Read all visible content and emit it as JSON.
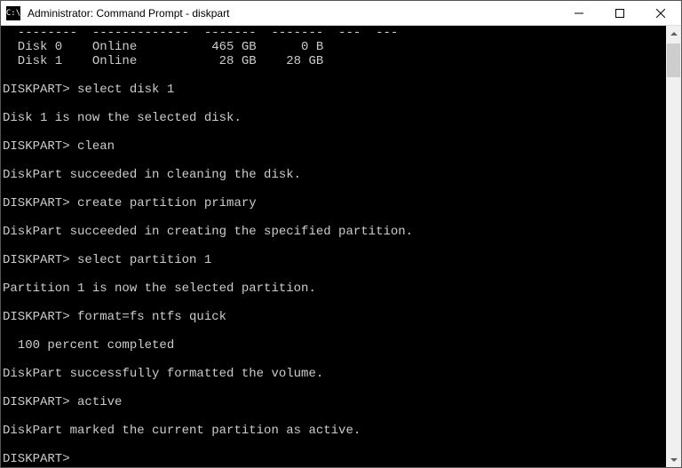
{
  "window": {
    "title": "Administrator: Command Prompt - diskpart"
  },
  "terminal": {
    "lines": [
      "  --------  -------------  -------  -------  ---  ---",
      "  Disk 0    Online          465 GB      0 B",
      "  Disk 1    Online           28 GB    28 GB",
      "",
      "DISKPART> select disk 1",
      "",
      "Disk 1 is now the selected disk.",
      "",
      "DISKPART> clean",
      "",
      "DiskPart succeeded in cleaning the disk.",
      "",
      "DISKPART> create partition primary",
      "",
      "DiskPart succeeded in creating the specified partition.",
      "",
      "DISKPART> select partition 1",
      "",
      "Partition 1 is now the selected partition.",
      "",
      "DISKPART> format=fs ntfs quick",
      "",
      "  100 percent completed",
      "",
      "DiskPart successfully formatted the volume.",
      "",
      "DISKPART> active",
      "",
      "DiskPart marked the current partition as active.",
      "",
      "DISKPART>"
    ]
  }
}
